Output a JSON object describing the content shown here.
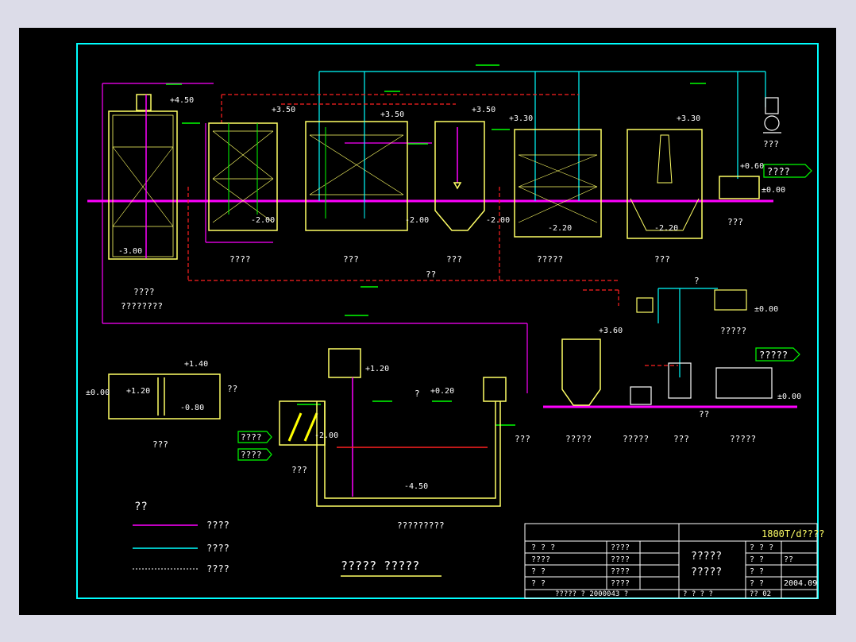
{
  "colors": {
    "sheet_border": "#00ffff",
    "ground": "#ff00ff",
    "tank": "#ffff66",
    "pipe_sludge": "#ff00ff",
    "pipe_air": "#00ffff",
    "pipe_return": "#ff2020",
    "flow_arrow": "#00ff00",
    "label": "#ffffff"
  },
  "elevations": {
    "e1": "+4.50",
    "e2": "+3.50",
    "e3": "+3.50",
    "e4": "+3.50",
    "e5": "+3.30",
    "e6": "+3.30",
    "e7": "+0.60",
    "e8": "±0.00",
    "e9": "-3.00",
    "e10": "-2.00",
    "e11": "-2.00",
    "e12": "-2.00",
    "e13": "-2.20",
    "e14": "-2.20",
    "e15": "±0.00",
    "e16": "+3.60",
    "e17": "±0.00",
    "e18": "+1.40",
    "e19": "±0.00",
    "e20": "+1.20",
    "e21": "-0.80",
    "e22": "+1.20",
    "e23": "+0.20",
    "e24": "-2.00",
    "e25": "-4.50"
  },
  "tank_labels": {
    "t1_a": "????",
    "t1_b": "????????",
    "t2": "????",
    "t3": "???",
    "t4": "???",
    "t5": "?????",
    "t6": "???",
    "blower": "???",
    "outlet_box": "????",
    "compressor": "?????",
    "mid": "??"
  },
  "bottom_labels": {
    "b1": "???",
    "b2": "?????",
    "b3": "?????",
    "b4": "???",
    "b5": "?????",
    "b6": "???",
    "b7": "???",
    "b8": "?????????",
    "b9": "????",
    "b10": "????",
    "q1": "??",
    "q2": "?",
    "q3": "?",
    "q4": "??",
    "q5": "???"
  },
  "legend": {
    "title": "??",
    "items": [
      "????",
      "????",
      "????"
    ]
  },
  "drawing_title": "?????  ?????",
  "title_block": {
    "project": "1800T/d????",
    "name_line1": "?????",
    "name_line2": "?????",
    "left_col1": [
      "? ? ?",
      "????",
      "?  ?",
      "?  ?"
    ],
    "left_col2": [
      "????",
      "????",
      "????",
      "????"
    ],
    "right_col1": [
      "? ? ?",
      "?  ?",
      "?  ?",
      "?  ?"
    ],
    "right_val": [
      "",
      "??",
      "",
      "2004.09"
    ],
    "footer_left": "?????   ?   2000043   ?",
    "footer_right": "?     ?    ?     ?",
    "sheet_no": "?? 02"
  }
}
